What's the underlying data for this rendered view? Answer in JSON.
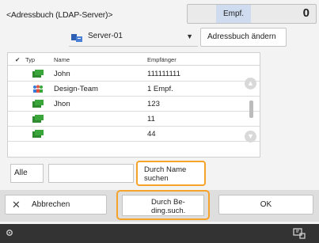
{
  "header": {
    "title": "<Adressbuch (LDAP-Server)>",
    "recipient_label": "Empf.",
    "recipient_count": "0"
  },
  "server": {
    "name": "Server-01",
    "change_button": "Adressbuch ändern"
  },
  "table": {
    "columns": {
      "check": "✔",
      "type": "Typ",
      "name": "Name",
      "recipient": "Empfänger"
    },
    "rows": [
      {
        "icon": "person-icon",
        "name": "John",
        "recipient": "111111111"
      },
      {
        "icon": "group-icon",
        "name": "Design-Team",
        "recipient": "1 Empf."
      },
      {
        "icon": "person-icon",
        "name": "Jhon",
        "recipient": "123"
      },
      {
        "icon": "person-icon",
        "name": "",
        "recipient": "11"
      },
      {
        "icon": "person-icon",
        "name": "",
        "recipient": "44"
      }
    ]
  },
  "search": {
    "all_button": "Alle",
    "input_value": "",
    "name_search_line1": "Durch Name",
    "name_search_line2": "suchen"
  },
  "actions": {
    "cancel": "Abbrechen",
    "cond_search_line1": "Durch Be-",
    "cond_search_line2": "ding.such.",
    "ok": "OK"
  },
  "colors": {
    "highlight": "#f5a32a",
    "recipient_label_bg": "#cfdcf0",
    "person_icon": "#2f8a2f",
    "group_icon": "#3a7bd5"
  }
}
